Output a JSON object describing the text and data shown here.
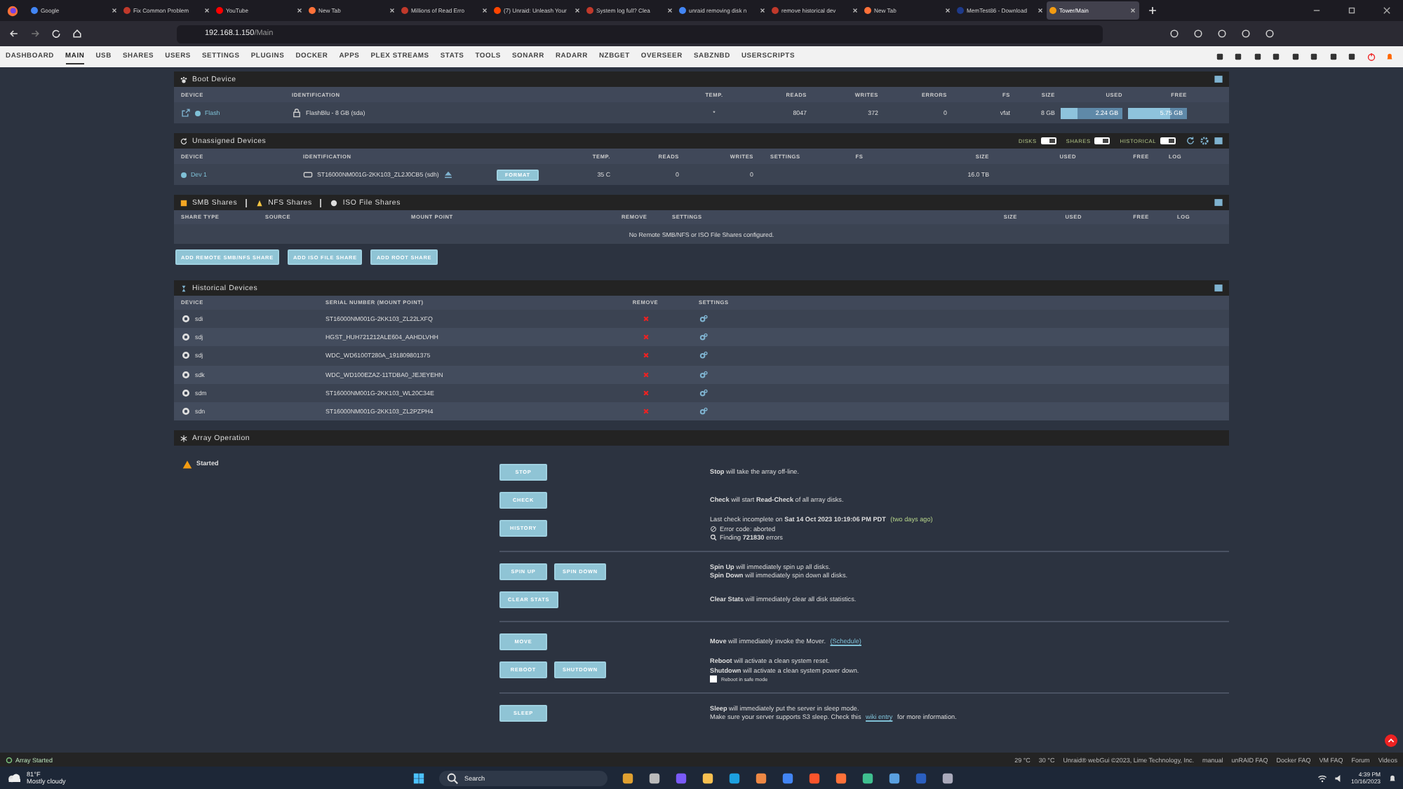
{
  "browser": {
    "tabs": [
      {
        "title": "Google",
        "selected": false
      },
      {
        "title": "Fix Common Problem",
        "selected": false
      },
      {
        "title": "YouTube",
        "selected": false
      },
      {
        "title": "New Tab",
        "selected": false
      },
      {
        "title": "Millions of Read Erro",
        "selected": false
      },
      {
        "title": "(7) Unraid: Unleash Your",
        "selected": false
      },
      {
        "title": "System log full? Clea",
        "selected": false
      },
      {
        "title": "unraid removing disk n",
        "selected": false
      },
      {
        "title": "remove historical dev",
        "selected": false
      },
      {
        "title": "New Tab",
        "selected": false
      },
      {
        "title": "MemTest86 - Download",
        "selected": false
      },
      {
        "title": "Tower/Main",
        "selected": true
      }
    ],
    "address": {
      "host": "192.168.1.150",
      "path": "/Main"
    }
  },
  "nav": [
    {
      "label": "DASHBOARD",
      "selected": false
    },
    {
      "label": "MAIN",
      "selected": true
    },
    {
      "label": "USB",
      "selected": false
    },
    {
      "label": "SHARES",
      "selected": false
    },
    {
      "label": "USERS",
      "selected": false
    },
    {
      "label": "SETTINGS",
      "selected": false
    },
    {
      "label": "PLUGINS",
      "selected": false
    },
    {
      "label": "DOCKER",
      "selected": false
    },
    {
      "label": "APPS",
      "selected": false
    },
    {
      "label": "PLEX STREAMS",
      "selected": false
    },
    {
      "label": "STATS",
      "selected": false
    },
    {
      "label": "TOOLS",
      "selected": false
    },
    {
      "label": "SONARR",
      "selected": false
    },
    {
      "label": "RADARR",
      "selected": false
    },
    {
      "label": "NZBGET",
      "selected": false
    },
    {
      "label": "OVERSEER",
      "selected": false
    },
    {
      "label": "SABZNBD",
      "selected": false
    },
    {
      "label": "USERSCRIPTS",
      "selected": false
    }
  ],
  "boot_device": {
    "title": "Boot Device",
    "columns": [
      "DEVICE",
      "IDENTIFICATION",
      "TEMP.",
      "READS",
      "WRITES",
      "ERRORS",
      "FS",
      "SIZE",
      "USED",
      "FREE"
    ],
    "rows": [
      {
        "device": "Flash",
        "identification": "FlashBlu - 8 GB (sda)",
        "temp": "*",
        "reads": "8047",
        "writes": "372",
        "errors": "0",
        "fs": "vfat",
        "size": "8 GB",
        "used": {
          "text": "2.24 GB",
          "level": 0.28
        },
        "free": {
          "text": "5.75 GB",
          "level": 0.72
        }
      }
    ]
  },
  "unassigned_devices": {
    "title": "Unassigned Devices",
    "toggles": [
      {
        "label": "DISKS",
        "on": true
      },
      {
        "label": "SHARES",
        "on": true
      },
      {
        "label": "HISTORICAL",
        "on": true
      }
    ],
    "columns": [
      "DEVICE",
      "IDENTIFICATION",
      "",
      "TEMP.",
      "READS",
      "WRITES",
      "SETTINGS",
      "FS",
      "SIZE",
      "USED",
      "FREE",
      "LOG"
    ],
    "rows": [
      {
        "device": "Dev 1",
        "identification": "ST16000NM001G-2KK103_ZL2J0CB5 (sdh)",
        "button": "FORMAT",
        "temp": "35 C",
        "reads": "0",
        "writes": "0",
        "size": "16.0 TB"
      }
    ]
  },
  "shares": {
    "tabs": [
      "SMB Shares",
      "NFS Shares",
      "ISO File Shares"
    ],
    "columns": [
      "SHARE TYPE",
      "SOURCE",
      "MOUNT POINT",
      "REMOVE",
      "SETTINGS",
      "SIZE",
      "USED",
      "FREE",
      "LOG"
    ],
    "message": "No Remote SMB/NFS or ISO File Shares configured.",
    "buttons": [
      "ADD REMOTE SMB/NFS SHARE",
      "ADD ISO FILE SHARE",
      "ADD ROOT SHARE"
    ]
  },
  "historical_devices": {
    "title": "Historical Devices",
    "columns": [
      "DEVICE",
      "SERIAL NUMBER (MOUNT POINT)",
      "REMOVE",
      "SETTINGS"
    ],
    "rows": [
      {
        "device": "sdi",
        "serial": "ST16000NM001G-2KK103_ZL22LXFQ"
      },
      {
        "device": "sdj",
        "serial": "HGST_HUH721212ALE604_AAHDLVHH"
      },
      {
        "device": "sdj",
        "serial": "WDC_WD6100T280A_191809801375"
      },
      {
        "device": "sdk",
        "serial": "WDC_WD100EZAZ-11TDBA0_JEJEYEHN"
      },
      {
        "device": "sdm",
        "serial": "ST16000NM001G-2KK103_WL20C34E"
      },
      {
        "device": "sdn",
        "serial": "ST16000NM001G-2KK103_ZL2PZPH4"
      }
    ]
  },
  "array_operation": {
    "title": "Array Operation",
    "status": "Started",
    "groups": [
      [
        {
          "buttons": [
            "STOP"
          ],
          "lines": [
            [
              {
                "text": "**Stop** will take the array off-line."
              }
            ]
          ]
        },
        {
          "buttons": [
            "CHECK"
          ],
          "lines": [
            [
              {
                "text": "**Check** will start **Read-Check** of all array disks."
              }
            ]
          ]
        },
        {
          "buttons": [
            "HISTORY"
          ],
          "lines": [
            [
              {
                "text": "Last check incomplete on **Sat 14 Oct 2023 10:19:06 PM PDT** "
              },
              {
                "text": "(two days ago)",
                "kind": "note"
              }
            ],
            [
              {
                "text": "Error code: aborted",
                "kind": "error_code"
              }
            ],
            [
              {
                "text": "Finding **721830** errors",
                "kind": "finding"
              }
            ]
          ]
        }
      ],
      [
        {
          "buttons": [
            "SPIN UP",
            "SPIN DOWN"
          ],
          "lines": [
            [
              {
                "text": "**Spin Up** will immediately spin up all disks."
              }
            ],
            [
              {
                "text": "**Spin Down** will immediately spin down all disks."
              }
            ]
          ]
        },
        {
          "buttons": [
            "CLEAR STATS"
          ],
          "lines": [
            [
              {
                "text": "**Clear Stats** will immediately clear all disk statistics."
              }
            ]
          ]
        }
      ],
      [
        {
          "buttons": [
            "MOVE"
          ],
          "lines": [
            [
              {
                "text": "**Move** will immediately invoke the Mover. "
              },
              {
                "text": "(Schedule)",
                "kind": "link"
              }
            ]
          ]
        },
        {
          "buttons": [
            "REBOOT",
            "SHUTDOWN"
          ],
          "lines": [
            [
              {
                "text": "**Reboot** will activate a clean system reset."
              }
            ],
            [
              {
                "text": "**Shutdown** will activate a clean system power down."
              }
            ]
          ],
          "checkbox": {
            "label": "Reboot in safe mode",
            "checked": false
          }
        }
      ],
      [
        {
          "buttons": [
            "SLEEP"
          ],
          "lines": [
            [
              {
                "text": "**Sleep** will immediately put the server in sleep mode."
              }
            ],
            [
              {
                "text": "Make sure your server supports S3 sleep. Check this "
              },
              {
                "text": "wiki entry",
                "kind": "link"
              },
              {
                "text": " for more information."
              }
            ]
          ]
        }
      ]
    ]
  },
  "status_bar": {
    "status": "Array Started",
    "temps": [
      "29 °C",
      "30 °C"
    ],
    "copyright": "Unraid® webGui ©2023, Lime Technology, Inc.",
    "links": [
      "manual",
      "unRAID FAQ",
      "Docker FAQ",
      "VM FAQ",
      "Forum",
      "Videos"
    ]
  },
  "taskbar": {
    "weather_temp": "81°F",
    "weather_text": "Mostly cloudy",
    "search": "Search",
    "time": "4:39 PM",
    "date": "10/16/2023"
  }
}
